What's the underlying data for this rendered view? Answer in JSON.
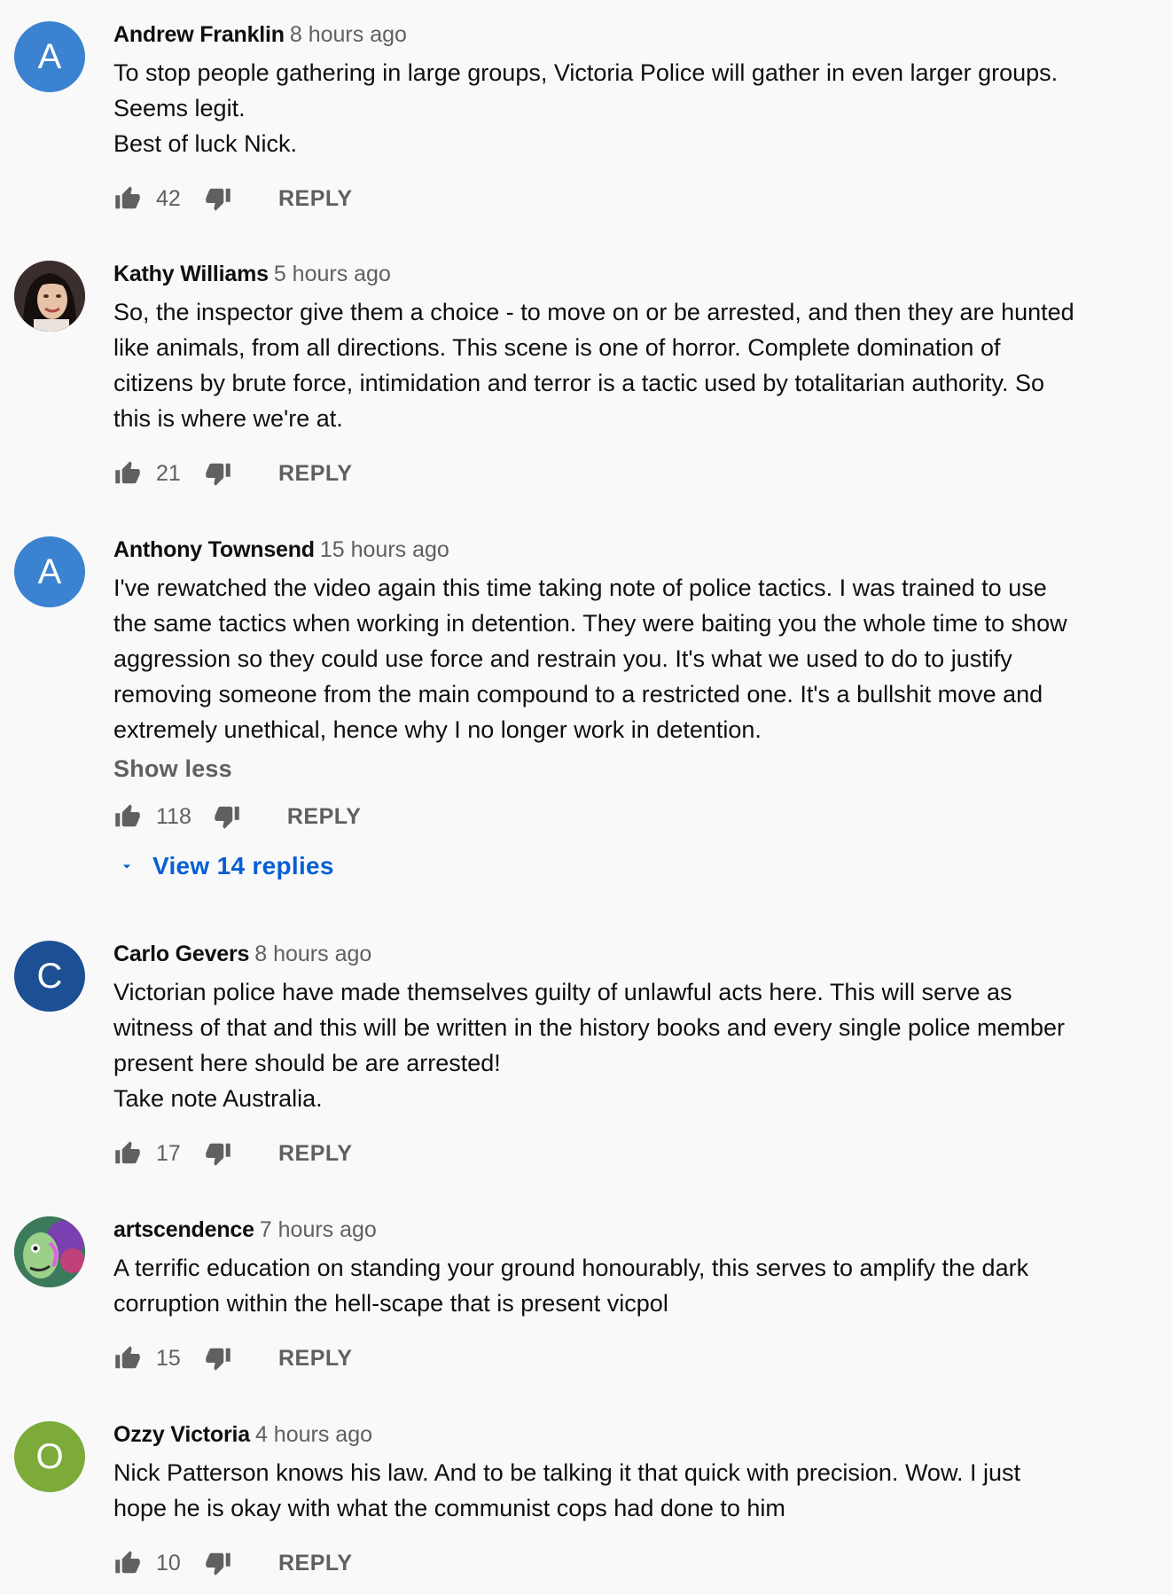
{
  "colors": {
    "avatar_a": "#3b82d0",
    "avatar_c": "#1c4f93",
    "avatar_o": "#7cab3a",
    "link": "#065fd4",
    "muted": "#606060"
  },
  "labels": {
    "reply": "REPLY"
  },
  "comments": [
    {
      "avatar_letter": "A",
      "author": "Andrew Franklin",
      "time": "8 hours ago",
      "lines": [
        "To stop people gathering in large groups, Victoria Police will gather in even larger groups.",
        "Seems legit.",
        "Best of luck Nick."
      ],
      "likes": "42"
    },
    {
      "avatar_image": "profile-photo-woman",
      "author": "Kathy Williams",
      "time": "5 hours ago",
      "lines": [
        "So, the inspector give them a choice - to move on or be arrested, and then they are hunted",
        "like animals, from all directions.  This scene is one of horror.  Complete domination of",
        "citizens by brute force, intimidation and terror is a tactic used by totalitarian authority.  So",
        "this is where we're at."
      ],
      "likes": "21"
    },
    {
      "avatar_letter": "A",
      "author": "Anthony Townsend",
      "time": "15 hours ago",
      "lines": [
        "I've rewatched the video again this time taking note of police tactics. I was trained to use",
        "the same tactics when working in detention. They were baiting you the whole time to show",
        "aggression so they could use force and restrain you. It's what we used to do to justify",
        "removing someone from the main compound to a restricted one. It's a bullshit move and",
        "extremely unethical, hence why I no longer work in detention."
      ],
      "show_less": "Show less",
      "likes": "118",
      "view_replies": "View 14 replies"
    },
    {
      "avatar_letter": "C",
      "author": "Carlo Gevers",
      "time": "8 hours ago",
      "lines": [
        "Victorian police have made themselves guilty of unlawful acts here. This will serve as",
        "witness of that and this will be written in the history books and every single police member",
        "present here should be are arrested!",
        "Take note Australia."
      ],
      "likes": "17"
    },
    {
      "avatar_image": "artistic-face-illustration",
      "author": "artscendence",
      "time": "7 hours ago",
      "lines": [
        "A terrific education on standing your ground honourably, this serves to amplify the dark",
        "corruption within the hell-scape that is present vicpol"
      ],
      "likes": "15"
    },
    {
      "avatar_letter": "O",
      "author": "Ozzy Victoria",
      "time": "4 hours ago",
      "lines": [
        "Nick Patterson knows his law. And to be talking it that quick with precision. Wow. I just",
        "hope he is okay with what the communist cops had done to him"
      ],
      "likes": "10"
    }
  ]
}
